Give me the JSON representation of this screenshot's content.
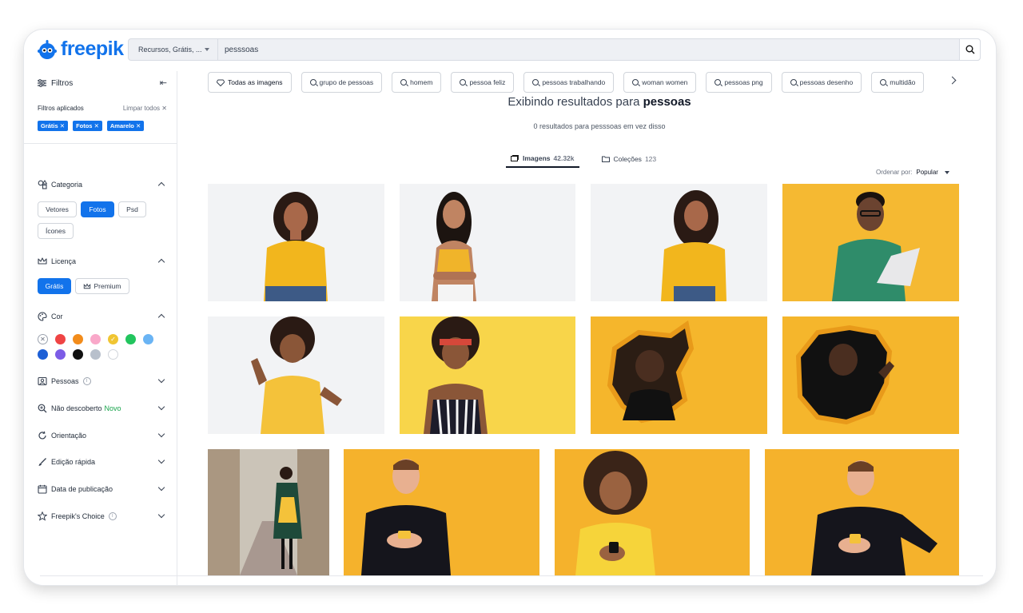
{
  "brand": {
    "name": "freepik",
    "color": "#1273eb"
  },
  "search": {
    "type_label": "Recursos, Grátis, ...",
    "query": "pesssoas"
  },
  "sidebar": {
    "title": "Filtros",
    "applied_label": "Filtros aplicados",
    "clear_label": "Limpar todos",
    "applied_chips": [
      "Grátis",
      "Fotos",
      "Amarelo"
    ],
    "categoria": {
      "label": "Categoria",
      "options": [
        "Vetores",
        "Fotos",
        "Psd",
        "Ícones"
      ],
      "selected": "Fotos"
    },
    "licenca": {
      "label": "Licença",
      "options": [
        "Grátis",
        "Premium"
      ],
      "selected": "Grátis"
    },
    "cor": {
      "label": "Cor",
      "swatches": [
        "#ffffff",
        "#ef4444",
        "#f28c1b",
        "#f9a8c9",
        "#f0c532",
        "#22c55e",
        "#6ab4f4",
        "#1d5fd6",
        "#7c5ce6",
        "#111111",
        "#b8c0cc",
        "#ffffff"
      ]
    },
    "pessoas": "Pessoas",
    "nao_descoberto": "Não descoberto",
    "novo": "Novo",
    "orientacao": "Orientação",
    "edicao": "Edição rápida",
    "data_publicacao": "Data de publicação",
    "choice": "Freepik's Choice"
  },
  "tags": [
    "Todas as imagens",
    "grupo de pessoas",
    "homem",
    "pessoa feliz",
    "pessoas trabalhando",
    "woman women",
    "pessoas png",
    "pessoas desenho",
    "multidão"
  ],
  "results": {
    "title_prefix": "Exibindo resultados para",
    "title_term": "pessoas",
    "subtitle": "0 resultados para pesssoas em vez disso"
  },
  "tabs": {
    "images_label": "Imagens",
    "images_count": "42.32k",
    "collections_label": "Coleções",
    "collections_count": "123"
  },
  "sort": {
    "label": "Ordenar por:",
    "value": "Popular"
  }
}
